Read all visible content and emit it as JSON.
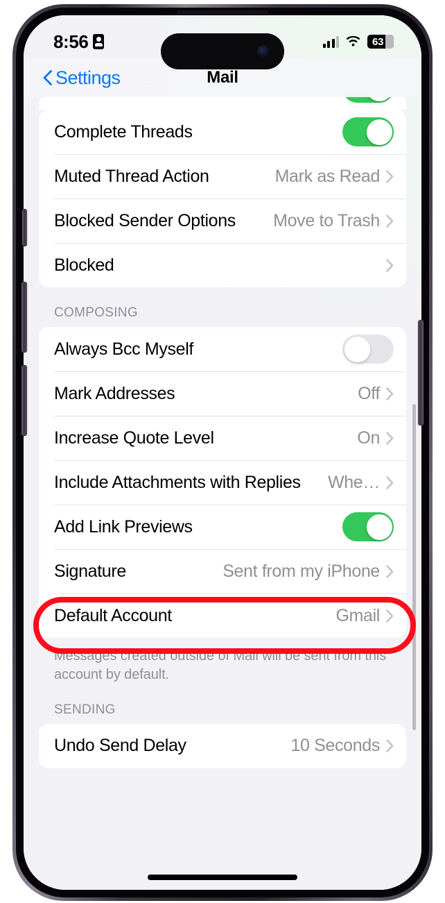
{
  "status_bar": {
    "time": "8:56",
    "lock_icon": "id-lock-icon",
    "cellular_icon": "cellular-signal-icon",
    "wifi_icon": "wifi-icon",
    "battery_level": "63"
  },
  "nav_bar": {
    "back_label": "Settings",
    "back_icon": "chevron-left-icon",
    "title": "Mail"
  },
  "colors": {
    "accent_blue": "#0a78f0",
    "toggle_on_green": "#34c759",
    "annotation_red": "#fc0d1b",
    "value_gray": "#8f8f95",
    "page_background": "#f2f1f6"
  },
  "sections": [
    {
      "header": "",
      "footer": "",
      "rows": [
        {
          "label": "Complete Threads",
          "type": "toggle",
          "value": "on"
        },
        {
          "label": "Muted Thread Action",
          "type": "link",
          "value": "Mark as Read"
        },
        {
          "label": "Blocked Sender Options",
          "type": "link",
          "value": "Move to Trash"
        },
        {
          "label": "Blocked",
          "type": "link",
          "value": ""
        }
      ]
    },
    {
      "header": "COMPOSING",
      "footer": "Messages created outside of Mail will be sent from this account by default.",
      "rows": [
        {
          "label": "Always Bcc Myself",
          "type": "toggle",
          "value": "off"
        },
        {
          "label": "Mark Addresses",
          "type": "link",
          "value": "Off"
        },
        {
          "label": "Increase Quote Level",
          "type": "link",
          "value": "On"
        },
        {
          "label": "Include Attachments with Replies",
          "type": "link",
          "value": "Whe…"
        },
        {
          "label": "Add Link Previews",
          "type": "toggle",
          "value": "on"
        },
        {
          "label": "Signature",
          "type": "link",
          "value": "Sent from my iPhone",
          "highlighted": true
        },
        {
          "label": "Default Account",
          "type": "link",
          "value": "Gmail"
        }
      ]
    },
    {
      "header": "SENDING",
      "footer": "",
      "rows": [
        {
          "label": "Undo Send Delay",
          "type": "link",
          "value": "10 Seconds"
        }
      ]
    }
  ],
  "annotation": {
    "target": "Signature",
    "shape": "red-rounded-oval"
  }
}
